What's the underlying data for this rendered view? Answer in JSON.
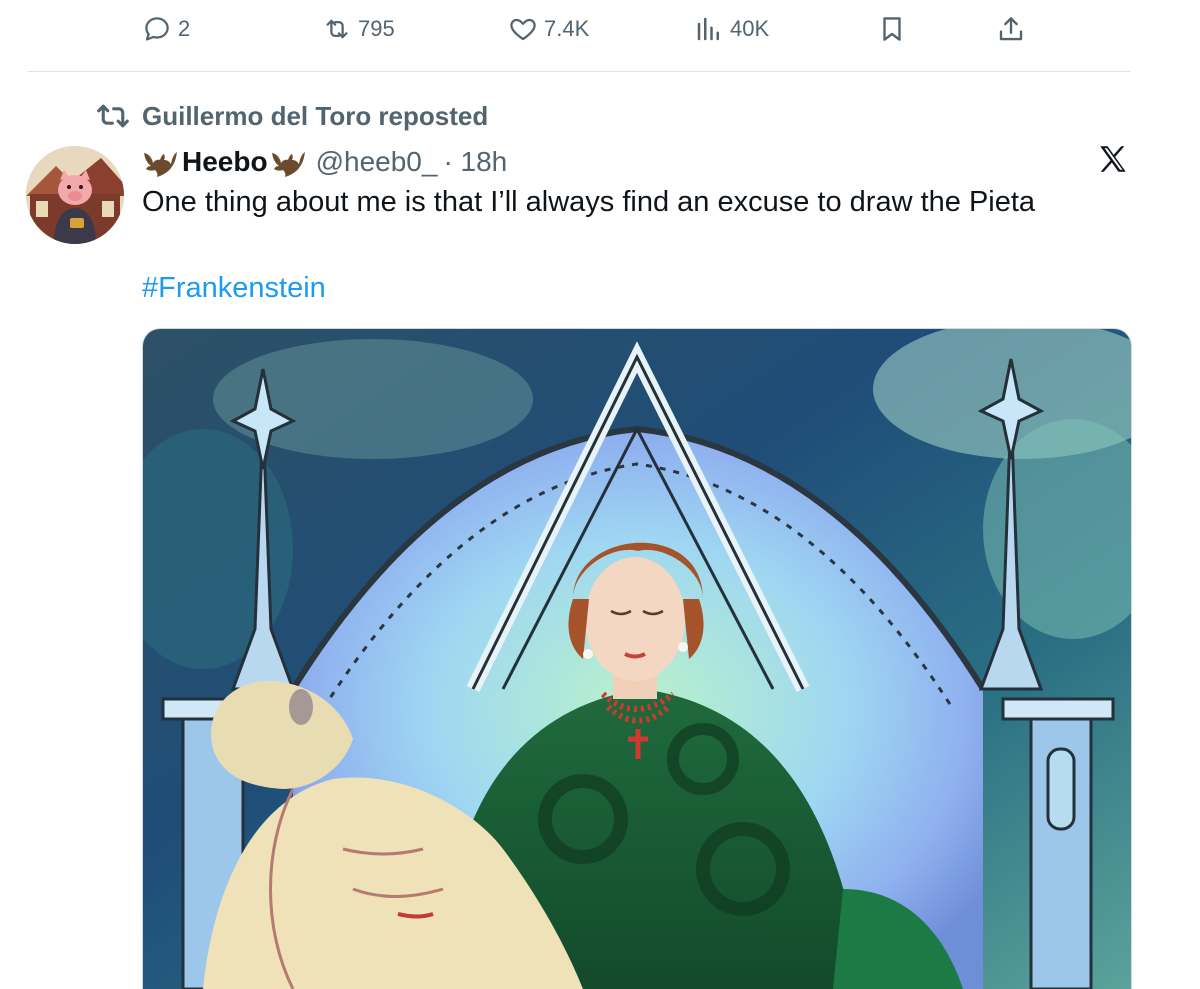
{
  "previous_tweet_actions": {
    "replies": "2",
    "reposts": "795",
    "likes": "7.4K",
    "views": "40K",
    "icons": [
      "reply-icon",
      "repost-icon",
      "heart-icon",
      "views-icon",
      "bookmark-icon",
      "share-icon"
    ]
  },
  "tweet": {
    "social_context": "Guillermo del Toro reposted",
    "display_name": "Heebo",
    "handle": "@heeb0_",
    "time": "· 18h",
    "text": "One thing about me is that I’ll always find an excuse to draw the Pieta",
    "hashtag": "#Frankenstein"
  },
  "colors": {
    "text_primary": "#0f1419",
    "text_secondary": "#536471",
    "link": "#1d9bf0",
    "divider": "#dfe3e6"
  }
}
